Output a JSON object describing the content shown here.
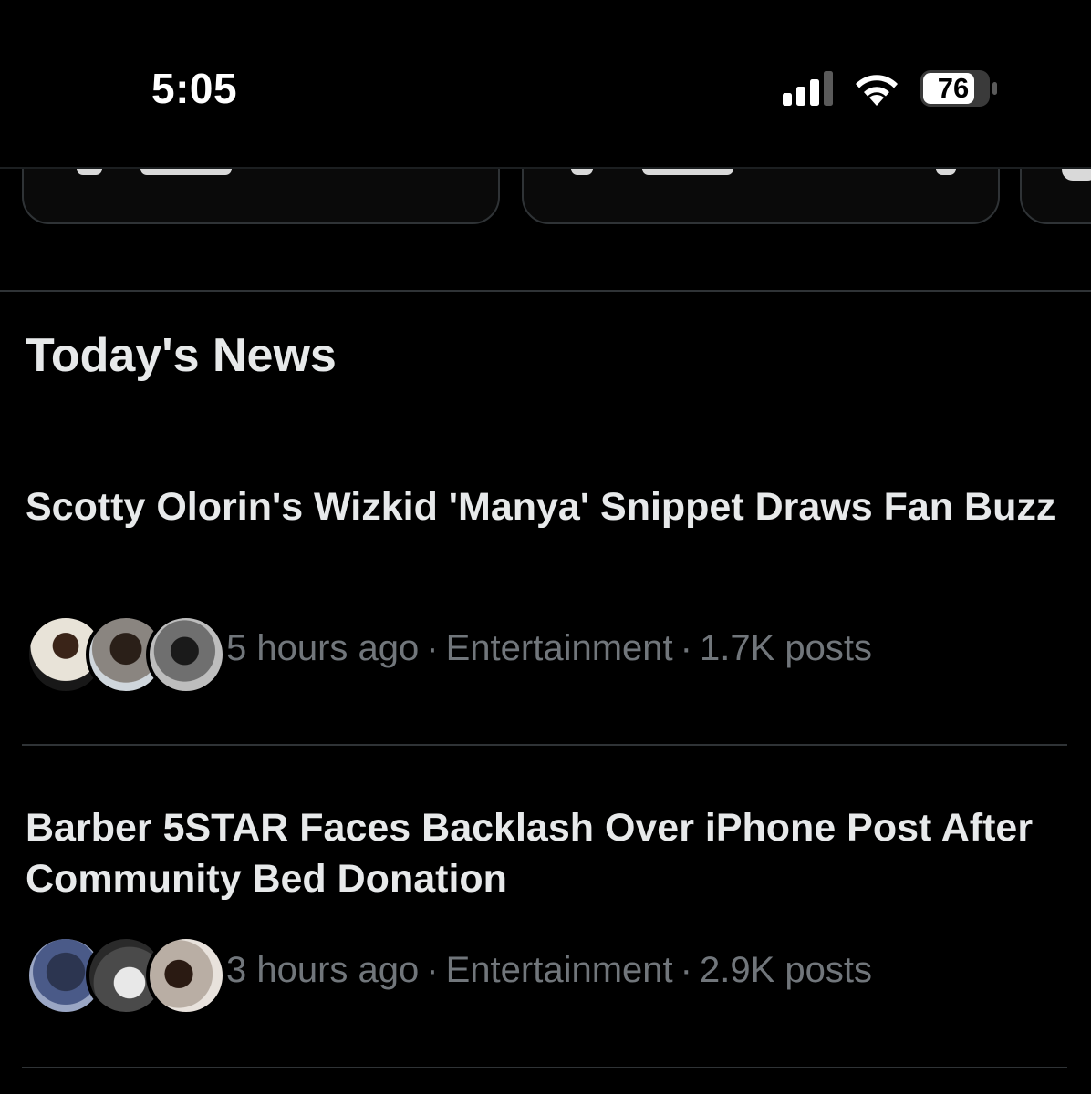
{
  "status_bar": {
    "time": "5:05",
    "battery": "76",
    "icons": [
      "signal-icon",
      "wifi-icon",
      "battery-icon"
    ]
  },
  "section": {
    "title": "Today's News"
  },
  "news": [
    {
      "headline": "Scotty Olorin's Wizkid 'Manya' Snippet Draws Fan Buzz",
      "time": "5 hours ago",
      "category": "Entertainment",
      "posts": "1.7K posts"
    },
    {
      "headline": "Barber 5STAR Faces Backlash Over iPhone Post After Community Bed Donation",
      "time": "3 hours ago",
      "category": "Entertainment",
      "posts": "2.9K posts"
    }
  ],
  "separator": "·",
  "colors": {
    "background": "#000000",
    "text_primary": "#e7e9ea",
    "text_secondary": "#71767b",
    "divider": "#2f3336"
  }
}
